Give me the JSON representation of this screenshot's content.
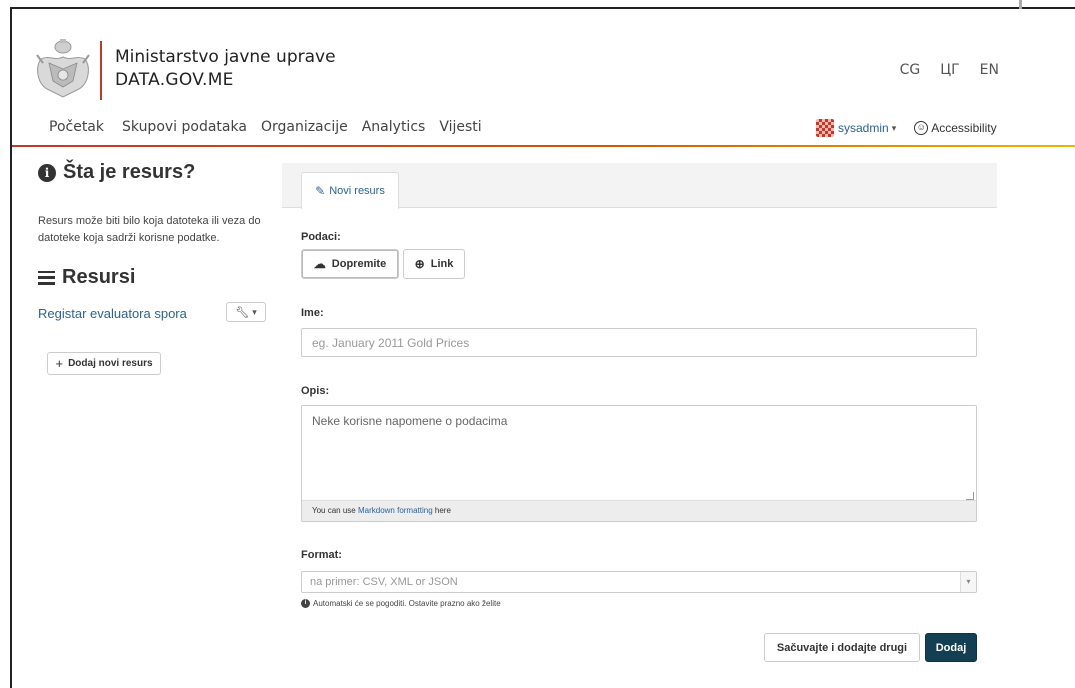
{
  "header": {
    "ministry": "Ministarstvo javne uprave",
    "domain": "DATA.GOV.ME",
    "languages": [
      "CG",
      "ЦГ",
      "EN"
    ]
  },
  "nav": {
    "items": [
      "Početak",
      "Skupovi podataka",
      "Organizacije",
      "Analytics",
      "Vijesti"
    ],
    "user": "sysadmin",
    "accessibility": "Accessibility"
  },
  "sidebar": {
    "title": "Šta je resurs?",
    "description": "Resurs može biti bilo koja datoteka ili veza do datoteke koja sadrži korisne podatke.",
    "resources_title": "Resursi",
    "resource_link": "Registar evaluatora spora",
    "add_button": "Dodaj novi resurs"
  },
  "form": {
    "tab": "Novi resurs",
    "data_label": "Podaci:",
    "upload_button": "Dopremite",
    "link_button": "Link",
    "name_label": "Ime:",
    "name_placeholder": "eg. January 2011 Gold Prices",
    "desc_label": "Opis:",
    "desc_placeholder": "Neke korisne napomene o podacima",
    "md_prefix": "You can use ",
    "md_link": "Markdown formatting",
    "md_suffix": " here",
    "format_label": "Format:",
    "format_placeholder": "na primer: CSV, XML or JSON",
    "format_hint": "Automatski će se pogoditi. Ostavite prazno ako želite",
    "save_another_button": "Sačuvajte i dodajte drugi",
    "add_button": "Dodaj"
  },
  "colors": {
    "accent_red": "#c0392b",
    "primary_button": "#133f52",
    "link": "#2a6496"
  },
  "icons": {
    "seal": "coat-of-arms-icon",
    "info": "info-circle-icon",
    "menu": "hamburger-icon",
    "upload": "cloud-upload-icon",
    "link": "globe-icon",
    "edit": "pencil-icon",
    "wrench": "wrench-icon",
    "accessibility": "accessibility-icon"
  }
}
